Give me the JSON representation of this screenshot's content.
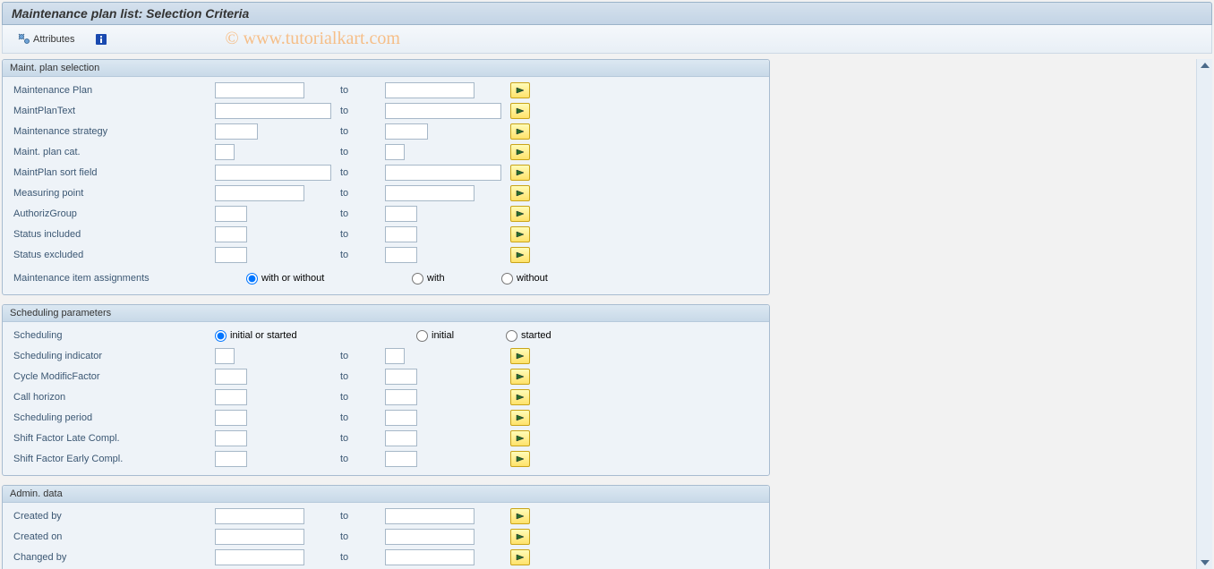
{
  "title": "Maintenance plan list: Selection Criteria",
  "toolbar": {
    "attributes_label": "Attributes"
  },
  "watermark": "© www.tutorialkart.com",
  "to_label": "to",
  "groups": {
    "plan_selection": {
      "header": "Maint. plan selection",
      "rows": {
        "maintenance_plan": "Maintenance Plan",
        "maint_plan_text": "MaintPlanText",
        "maintenance_strategy": "Maintenance strategy",
        "maint_plan_cat": "Maint. plan cat.",
        "maint_plan_sort_field": "MaintPlan sort field",
        "measuring_point": "Measuring point",
        "authoriz_group": "AuthorizGroup",
        "status_included": "Status included",
        "status_excluded": "Status excluded",
        "maint_item_assignments": "Maintenance item assignments"
      },
      "radio": {
        "opt1": "with or without",
        "opt2": "with",
        "opt3": "without"
      }
    },
    "scheduling": {
      "header": "Scheduling parameters",
      "rows": {
        "scheduling": "Scheduling",
        "scheduling_indicator": "Scheduling indicator",
        "cycle_modific_factor": "Cycle ModificFactor",
        "call_horizon": "Call horizon",
        "scheduling_period": "Scheduling period",
        "shift_factor_late": "Shift Factor Late Compl.",
        "shift_factor_early": "Shift Factor Early Compl."
      },
      "radio": {
        "opt1": "initial or started",
        "opt2": "initial",
        "opt3": "started"
      }
    },
    "admin": {
      "header": "Admin. data",
      "rows": {
        "created_by": "Created by",
        "created_on": "Created on",
        "changed_by": "Changed by"
      }
    }
  }
}
